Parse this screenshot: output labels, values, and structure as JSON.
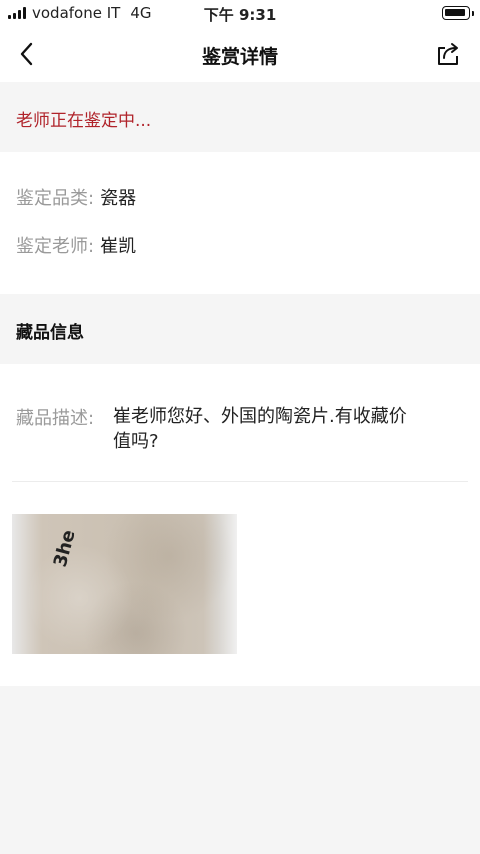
{
  "status_bar": {
    "carrier": "vodafone IT",
    "network": "4G",
    "time": "下午 9:31"
  },
  "nav": {
    "title": "鉴赏详情",
    "back_icon": "chevron-left-icon",
    "share_icon": "share-icon"
  },
  "appraisal_status": "老师正在鉴定中...",
  "info": {
    "category_label": "鉴定品类:",
    "category_value": "瓷器",
    "teacher_label": "鉴定老师:",
    "teacher_value": "崔凯"
  },
  "collection": {
    "section_title": "藏品信息",
    "desc_label": "藏品描述:",
    "desc_text": "崔老师您好、外国的陶瓷片.有收藏价值吗?",
    "photo_mark": "3he"
  },
  "colors": {
    "status_red": "#b0232a",
    "label_gray": "#9a9a9a",
    "background": "#f5f5f5"
  }
}
